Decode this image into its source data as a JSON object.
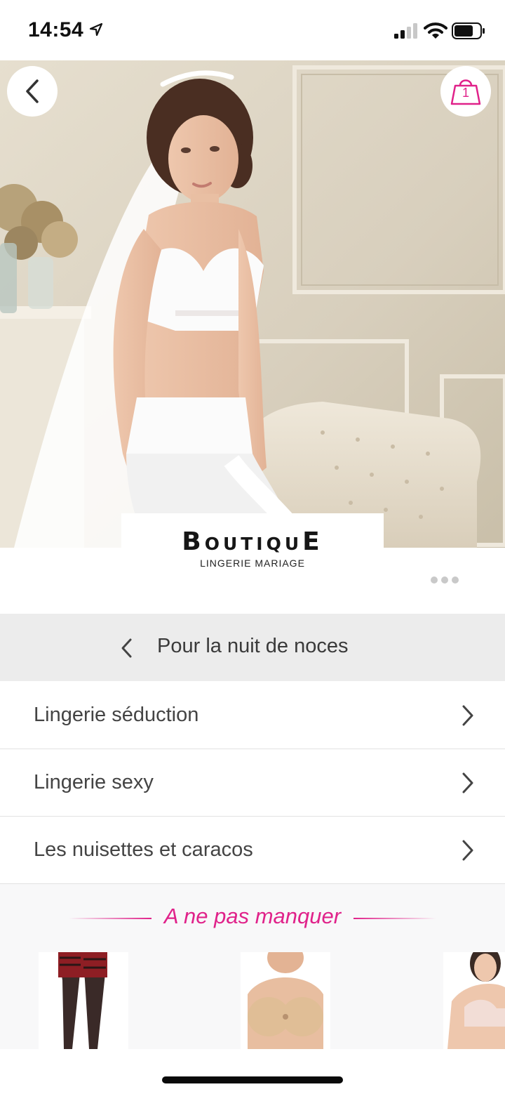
{
  "status_bar": {
    "time": "14:54",
    "icons": [
      "location-arrow-icon",
      "cellular-signal-icon",
      "wifi-icon",
      "battery-icon"
    ]
  },
  "header": {
    "back_icon": "chevron-left-icon",
    "cart_icon": "shopping-bag-icon",
    "cart_count": "1"
  },
  "brand": {
    "name": "BoutiquE",
    "subtitle": "LINGERIE MARIAGE"
  },
  "category": {
    "title": "Pour la nuit de noces",
    "items": [
      {
        "label": "Lingerie séduction"
      },
      {
        "label": "Lingerie sexy"
      },
      {
        "label": "Les nuisettes et caracos"
      }
    ]
  },
  "promo": {
    "title": "A ne pas manquer"
  },
  "colors": {
    "accent": "#e0228a",
    "header_bg": "#ececec",
    "divider": "#e2e2e2"
  }
}
